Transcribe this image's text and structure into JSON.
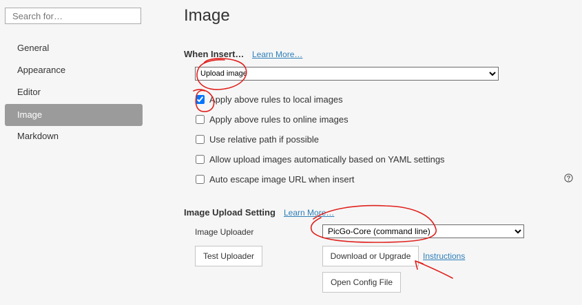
{
  "sidebar": {
    "search_placeholder": "Search for…",
    "items": [
      {
        "label": "General"
      },
      {
        "label": "Appearance"
      },
      {
        "label": "Editor"
      },
      {
        "label": "Image",
        "active": true
      },
      {
        "label": "Markdown"
      }
    ]
  },
  "page": {
    "title": "Image",
    "when_insert": {
      "heading": "When Insert…",
      "learn_more": "Learn More…",
      "selected_action": "Upload image",
      "options": [
        {
          "label": "Apply above rules to local images",
          "checked": true
        },
        {
          "label": "Apply above rules to online images",
          "checked": false
        },
        {
          "label": "Use relative path if possible",
          "checked": false
        },
        {
          "label": "Allow upload images automatically based on YAML settings",
          "checked": false
        },
        {
          "label": "Auto escape image URL when insert",
          "checked": false
        }
      ],
      "help_icon": "question-circle-icon"
    },
    "upload_setting": {
      "heading": "Image Upload Setting",
      "learn_more": "Learn More…",
      "uploader_label": "Image Uploader",
      "uploader_value": "PicGo-Core (command line)",
      "test_button": "Test Uploader",
      "download_button": "Download or Upgrade",
      "instructions_link": "Instructions",
      "open_config_button": "Open Config File"
    }
  },
  "annotation_color": "#e0201c"
}
